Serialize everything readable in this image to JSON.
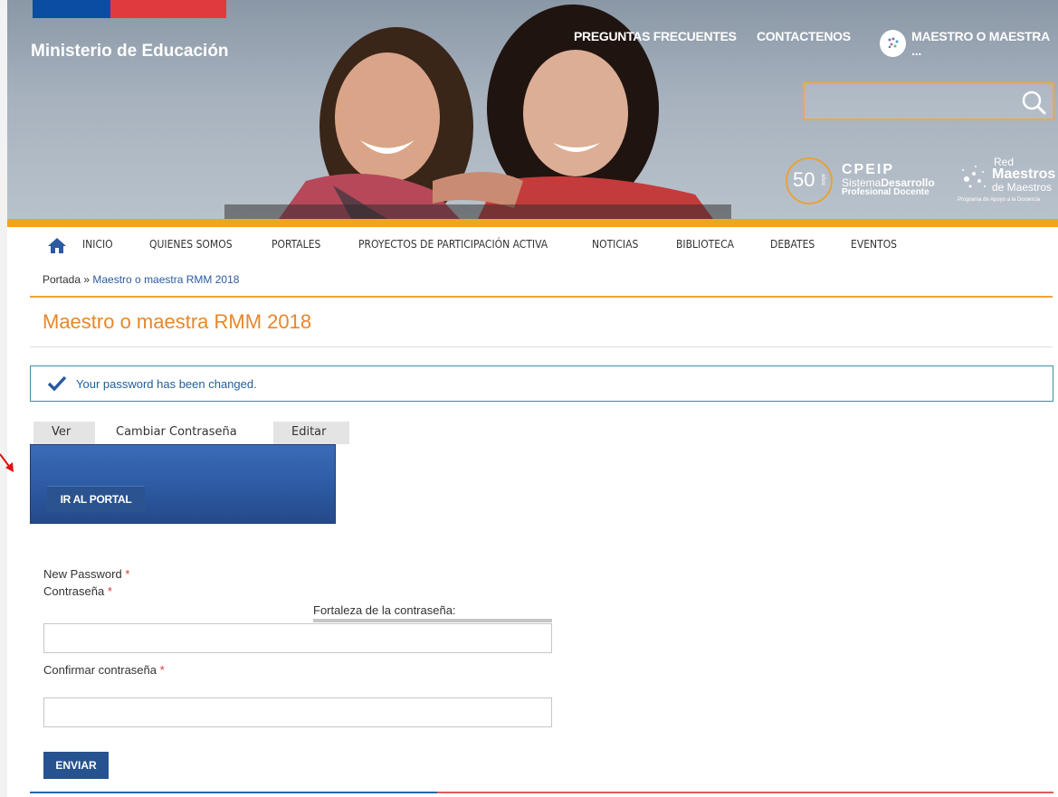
{
  "header": {
    "ministry": "Ministerio de Educación",
    "links": {
      "faq": "PREGUNTAS FRECUENTES",
      "contact": "CONTACTENOS",
      "user": "MAESTRO O MAESTRA ..."
    },
    "search": {
      "placeholder": ""
    },
    "logos": {
      "fifty": "50",
      "fifty_small": "años",
      "cpeip_title": "CPEIP",
      "cpeip_line1": "Sistema",
      "cpeip_line1b": "Desarrollo",
      "cpeip_line2": "Profesional Docente",
      "rmm_red": "Red",
      "rmm_maestros": "Maestros",
      "rmm_de": "de Maestros",
      "rmm_tagline": "Programa de Apoyo a la Docencia"
    }
  },
  "nav": {
    "items": [
      "INICIO",
      "QUIENES SOMOS",
      "PORTALES",
      "PROYECTOS DE PARTICIPACIÓN ACTIVA",
      "NOTICIAS",
      "BIBLIOTECA",
      "DEBATES",
      "EVENTOS"
    ]
  },
  "breadcrumb": {
    "home": "Portada",
    "sep": " » ",
    "current": "Maestro o maestra RMM 2018"
  },
  "page": {
    "title": "Maestro o maestra RMM 2018"
  },
  "status": {
    "message": "Your password has been changed."
  },
  "tabs": [
    "Ver",
    "Cambiar Contraseña",
    "Editar"
  ],
  "portal": {
    "button": "IR AL PORTAL"
  },
  "form": {
    "new_password_label": "New Password",
    "password_label": "Contraseña",
    "strength_label": "Fortaleza de la contraseña:",
    "confirm_label": "Confirmar contraseña",
    "required_mark": "*",
    "password_value": "",
    "confirm_value": "",
    "submit": "ENVIAR"
  },
  "colors": {
    "accent_orange": "#f0a51e",
    "brand_blue": "#26528f",
    "title_orange": "#e8862a"
  }
}
